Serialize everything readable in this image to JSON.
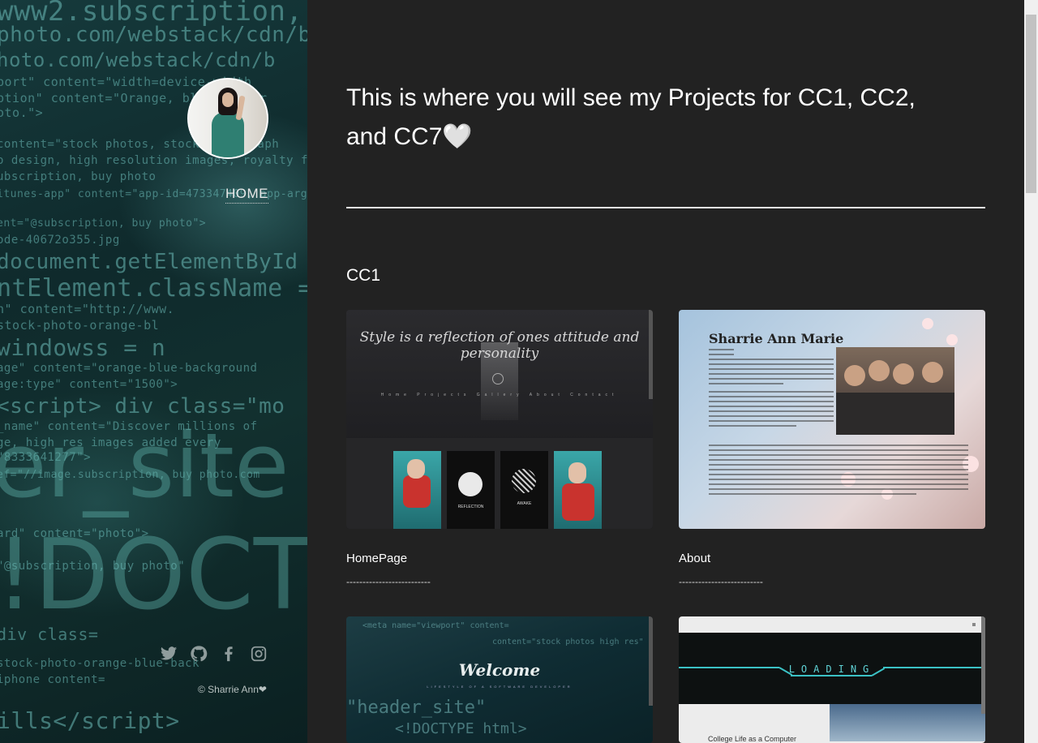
{
  "sidebar": {
    "nav_home": "HOME",
    "socials": [
      {
        "icon": "twitter-icon"
      },
      {
        "icon": "github-icon"
      },
      {
        "icon": "facebook-icon"
      },
      {
        "icon": "instagram-icon"
      }
    ],
    "copyright": "© Sharrie Ann",
    "copyright_heart": "❤"
  },
  "main": {
    "title": "This is where you will see my Projects for CC1, CC2, and CC7",
    "title_heart": "🤍",
    "section": "CC1",
    "cards": [
      {
        "label": "HomePage",
        "dash": "--------------------------",
        "thumb_quote": "Style is a reflection of ones attitude and personality",
        "poster_labels": [
          "REFLECTION",
          "AWAKE"
        ]
      },
      {
        "label": "About",
        "dash": "--------------------------",
        "thumb_name": "Sharrie Ann Marie"
      },
      {
        "label": "",
        "thumb_title": "Welcome"
      },
      {
        "label": "",
        "thumb_title": "LOADING"
      }
    ]
  },
  "colors": {
    "page_bg": "#222222",
    "sidebar_teal": "#163a3c",
    "accent_cyan": "#5fd3d6"
  }
}
